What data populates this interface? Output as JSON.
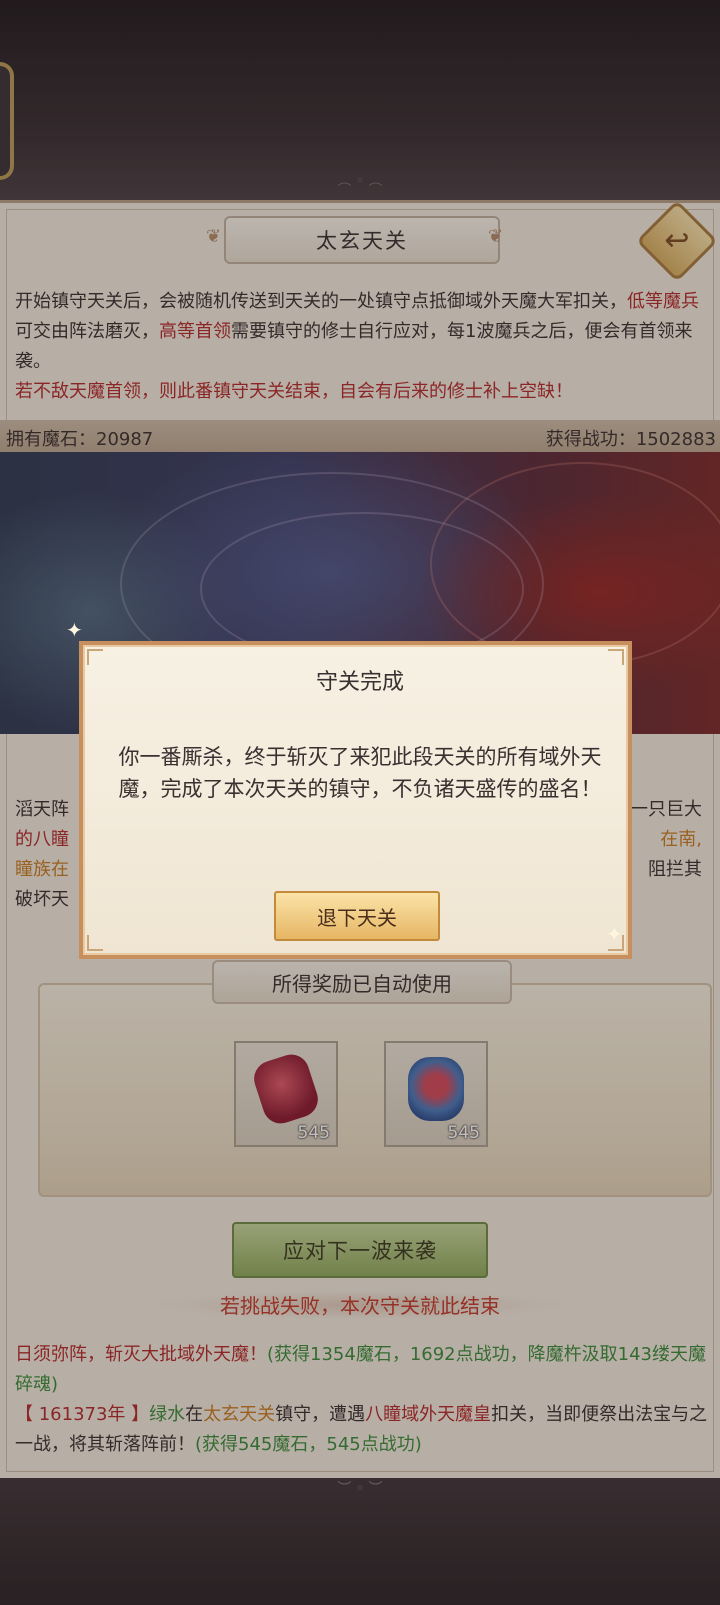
{
  "header": {
    "title": "太玄天关"
  },
  "intro": {
    "line1": "开始镇守天关后，会被随机传送到天关的一处镇守点抵御域外天魔大军扣关，",
    "low_enemy": "低等魔兵",
    "mid1": "可交由阵法磨灭，",
    "high_enemy": "高等首领",
    "mid2": "需要镇守的修士自行应对，每1波魔兵之后，便会有首领来袭。",
    "warning": "若不敌天魔首领，则此番镇守天关结束，自会有后来的修士补上空缺！"
  },
  "stats": {
    "magic_stones": "拥有魔石：20987",
    "merit": "获得战功：1502883"
  },
  "lore": {
    "l1a": "滔天阵",
    "l1b": "一只巨大",
    "l2a": "的八瞳",
    "l2b": "在南,",
    "l3a": "瞳族在",
    "l3b": "阻拦其",
    "l4a": "破坏天"
  },
  "rewards": {
    "title": "所得奖励已自动使用",
    "items": [
      {
        "icon": "red-crystal-icon",
        "count": "545"
      },
      {
        "icon": "blue-amulet-icon",
        "count": "545"
      }
    ]
  },
  "actions": {
    "next_wave": "应对下一波来袭",
    "fail_note": "若挑战失败，本次守关就此结束"
  },
  "log": {
    "e1_name": "日须弥阵，斩灭大批域外天魔！",
    "e1_reward": "(获得1354魔石，1692点战功，降魔杵汲取143缕天魔碎魂)",
    "e2_year": "【 161373年 】",
    "e2_player": "绿水",
    "e2_at": "在",
    "e2_place": "太玄天关",
    "e2_mid": "镇守，遭遇",
    "e2_boss": "八瞳域外天魔皇",
    "e2_rest": "扣关，当即便祭出法宝与之一战，将其斩落阵前！",
    "e2_reward": "(获得545魔石，545点战功)"
  },
  "modal": {
    "title": "守关完成",
    "body": "你一番厮杀，终于斩灭了来犯此段天关的所有域外天魔，完成了本次天关的镇守，不负诸天盛传的盛名！",
    "button": "退下天关"
  },
  "colors": {
    "warning_red": "#b22a2a",
    "highlight_orange": "#c57a22",
    "reward_green": "#3b8a3a",
    "modal_border": "#c78f5e"
  }
}
